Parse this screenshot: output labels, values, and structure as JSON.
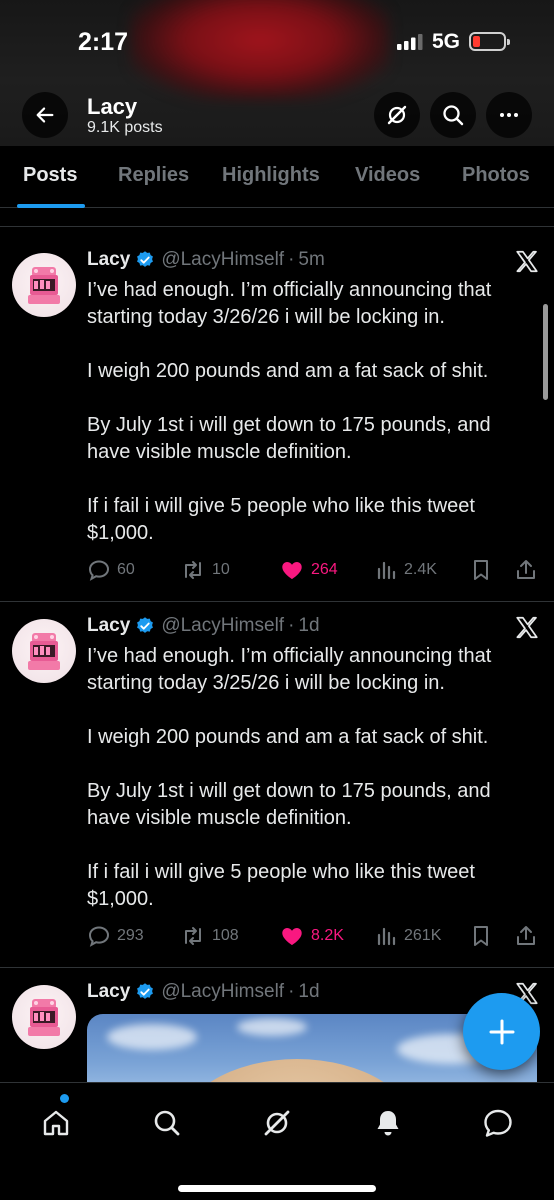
{
  "status_bar": {
    "time": "2:17",
    "network": "5G"
  },
  "header": {
    "name": "Lacy",
    "posts_count": "9.1K posts"
  },
  "tabs": [
    {
      "label": "Posts",
      "active": true
    },
    {
      "label": "Replies",
      "active": false
    },
    {
      "label": "Highlights",
      "active": false
    },
    {
      "label": "Videos",
      "active": false
    },
    {
      "label": "Photos",
      "active": false
    }
  ],
  "tweets": [
    {
      "name": "Lacy",
      "handle": "@LacyHimself",
      "separator": "·",
      "time": "5m",
      "paragraphs": [
        "I’ve had enough. I’m officially announcing that starting today 3/26/26 i will be locking in.",
        "I weigh 200 pounds and am a fat sack of shit.",
        "By July 1st i will get down to 175 pounds, and have visible muscle definition.",
        "If i fail i will give 5 people who like this tweet $1,000."
      ],
      "replies": "60",
      "reposts": "10",
      "likes": "264",
      "views": "2.4K"
    },
    {
      "name": "Lacy",
      "handle": "@LacyHimself",
      "separator": "·",
      "time": "1d",
      "paragraphs": [
        "I’ve had enough. I’m officially announcing that starting today 3/25/26 i will be locking in.",
        "I weigh 200 pounds and am a fat sack of shit.",
        "By July 1st i will get down to 175 pounds, and have visible muscle definition.",
        "If i fail i will give 5 people who like this tweet $1,000."
      ],
      "replies": "293",
      "reposts": "108",
      "likes": "8.2K",
      "views": "261K"
    },
    {
      "name": "Lacy",
      "handle": "@LacyHimself",
      "separator": "·",
      "time": "1d"
    }
  ],
  "colors": {
    "accent": "#1d9bf0",
    "like": "#f91880",
    "muted": "#71767b",
    "text": "#e7e9ea",
    "background": "#000000",
    "battery_low": "#ff3b30"
  },
  "icons": {
    "back": "arrow-left-icon",
    "grok": "grok-icon",
    "search": "search-icon",
    "more": "more-icon",
    "verified": "verified-badge-icon",
    "platform": "x-logo-icon",
    "reply": "reply-icon",
    "repost": "repost-icon",
    "like": "heart-icon",
    "views": "views-icon",
    "bookmark": "bookmark-icon",
    "share": "share-icon",
    "compose": "plus-icon",
    "nav": [
      "home-icon",
      "search-icon",
      "grok-icon",
      "bell-icon",
      "messages-icon"
    ]
  }
}
